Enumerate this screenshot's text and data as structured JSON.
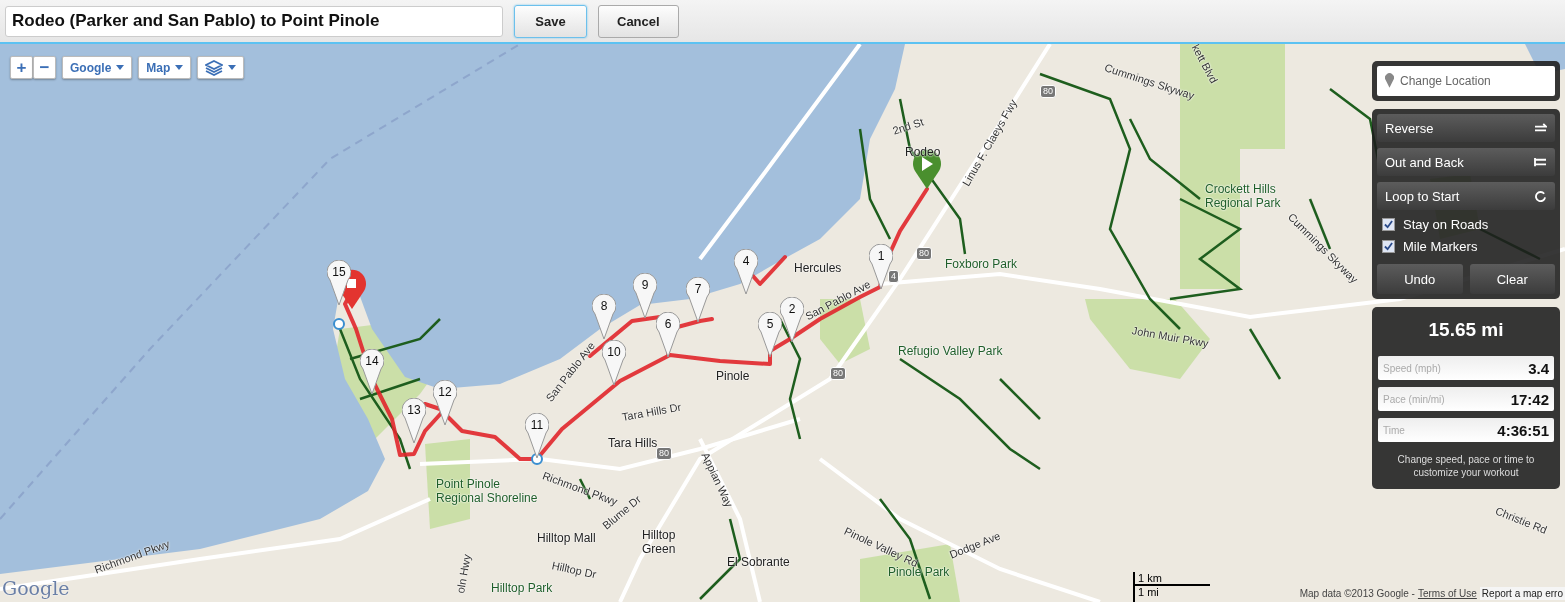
{
  "title_field": {
    "value": "Rodeo (Parker and San Pablo) to Point Pinole"
  },
  "header_buttons": [
    {
      "label": "Save",
      "focused": true
    },
    {
      "label": "Cancel",
      "focused": false
    }
  ],
  "map_controls": {
    "zoom_in": "+",
    "zoom_out": "−",
    "dropdowns": [
      {
        "kind": "text",
        "label": "Google"
      },
      {
        "kind": "text",
        "label": "Map"
      },
      {
        "kind": "layers"
      }
    ]
  },
  "route_panel": {
    "location": {
      "placeholder": "Change Location"
    },
    "actions": [
      {
        "kind": "reverse",
        "label": "Reverse"
      },
      {
        "kind": "out-and-back",
        "label": "Out and Back"
      },
      {
        "kind": "loop",
        "label": "Loop to Start"
      }
    ],
    "options": [
      {
        "label": "Stay on Roads",
        "checked": true
      },
      {
        "label": "Mile Markers",
        "checked": true
      }
    ],
    "edit_buttons": [
      "Undo",
      "Clear"
    ]
  },
  "stats": {
    "distance": "15.65 mi",
    "fields": [
      {
        "label": "Speed (mph)",
        "value": "3.4"
      },
      {
        "label": "Pace (min/mi)",
        "value": "17:42"
      },
      {
        "label": "Time",
        "value": "4:36:51"
      }
    ],
    "hint": "Change speed, pace or time to customize your workout"
  },
  "map": {
    "mile_markers": [
      "1",
      "2",
      "4",
      "5",
      "6",
      "7",
      "8",
      "9",
      "10",
      "11",
      "12",
      "13",
      "14",
      "15"
    ],
    "places": [
      {
        "kind": "road",
        "label": "Cummings Skyway"
      },
      {
        "kind": "road",
        "label": "kett Blvd"
      },
      {
        "kind": "road",
        "label": "2nd St"
      },
      {
        "kind": "town",
        "label": "Rodeo"
      },
      {
        "kind": "road",
        "label": "Linus F. Claeys Fwy"
      },
      {
        "kind": "park",
        "label": "Crockett Hills Regional Park"
      },
      {
        "kind": "road",
        "label": "Cummings Skyway"
      },
      {
        "kind": "town",
        "label": "Hercules"
      },
      {
        "kind": "park",
        "label": "Foxboro Park"
      },
      {
        "kind": "road",
        "label": "San Pablo Ave"
      },
      {
        "kind": "park",
        "label": "Refugio Valley Park"
      },
      {
        "kind": "road",
        "label": "John Muir Pkwy"
      },
      {
        "kind": "town",
        "label": "Pinole"
      },
      {
        "kind": "road",
        "label": "San Pablo Ave"
      },
      {
        "kind": "road",
        "label": "Tara Hills Dr"
      },
      {
        "kind": "town",
        "label": "Tara Hills"
      },
      {
        "kind": "road",
        "label": "Appian Way"
      },
      {
        "kind": "road",
        "label": "Richmond Pkwy"
      },
      {
        "kind": "road",
        "label": "Blume Dr"
      },
      {
        "kind": "town",
        "label": "Hilltop Mall"
      },
      {
        "kind": "town",
        "label": "Hilltop Green"
      },
      {
        "kind": "road",
        "label": "Hilltop Dr"
      },
      {
        "kind": "park",
        "label": "Hilltop Park"
      },
      {
        "kind": "road",
        "label": "oln Hwy"
      },
      {
        "kind": "town",
        "label": "El Sobrante"
      },
      {
        "kind": "road",
        "label": "Pinole Valley Rd"
      },
      {
        "kind": "road",
        "label": "Dodge Ave"
      },
      {
        "kind": "park",
        "label": "Pinole Park"
      },
      {
        "kind": "road",
        "label": "Christie Rd"
      },
      {
        "kind": "road",
        "label": "Richmond Pkwy"
      },
      {
        "kind": "park",
        "label": "Point Pinole Regional Shoreline"
      }
    ],
    "shields": [
      "80",
      "80",
      "4",
      "80",
      "80"
    ],
    "scale": {
      "metric": "1 km",
      "imperial": "1 mi"
    },
    "logo": "Google",
    "attribution": {
      "text": "Map data ©2013 Google -",
      "terms": "Terms of Use",
      "report": "Report a map erro"
    }
  }
}
